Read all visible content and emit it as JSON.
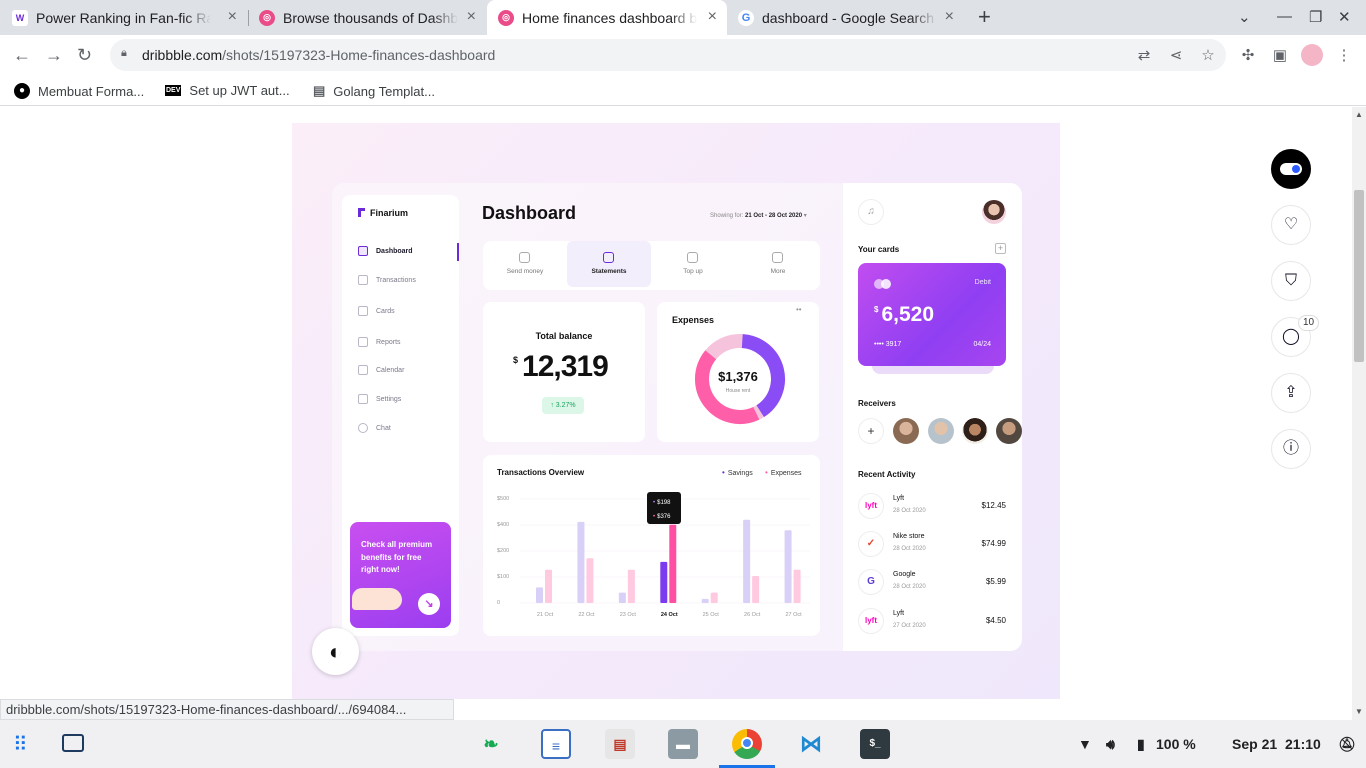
{
  "browser": {
    "tabs": [
      {
        "title": "Power Ranking in Fan-fic Ra",
        "favicon": "W"
      },
      {
        "title": "Browse thousands of Dashb",
        "favicon": "dribbble"
      },
      {
        "title": "Home finances dashboard b",
        "favicon": "dribbble"
      },
      {
        "title": "dashboard - Google Search",
        "favicon": "G"
      }
    ],
    "new_tab": "+",
    "url_host": "dribbble.com",
    "url_path": "/shots/15197323-Home-finances-dashboard",
    "bookmarks": [
      "Membuat Forma...",
      "Set up JWT aut...",
      "Golang Templat..."
    ],
    "status_url": "dribbble.com/shots/15197323-Home-finances-dashboard/.../694084..."
  },
  "dashboard": {
    "brand": "Finarium",
    "nav": [
      "Dashboard",
      "Transactions",
      "Cards",
      "Reports",
      "Calendar",
      "Settings",
      "Chat"
    ],
    "promo": "Check all premium benefits for free right now!",
    "title": "Dashboard",
    "showing_label": "Showing for:",
    "showing_range": "21 Oct - 28 Oct 2020",
    "actions": [
      "Send money",
      "Statements",
      "Top up",
      "More"
    ],
    "total_balance": {
      "label": "Total balance",
      "currency": "$",
      "amount": "12,319",
      "change": "3.27%"
    },
    "expenses": {
      "label": "Expenses",
      "amount": "$1,376",
      "sub": "House rent"
    },
    "overview": {
      "title": "Transactions Overview",
      "legend": [
        "Savings",
        "Expenses"
      ],
      "tooltip": [
        "$198",
        "$376"
      ]
    },
    "right": {
      "cards_label": "Your cards",
      "card": {
        "type": "Debit",
        "currency": "$",
        "amount": "6,520",
        "number": "•••• 3917",
        "expiry": "04/24"
      },
      "receivers_label": "Receivers",
      "activity_label": "Recent Activity",
      "activity": [
        {
          "name": "Lyft",
          "date": "28 Oct 2020",
          "amount": "$12.45"
        },
        {
          "name": "Nike store",
          "date": "28 Oct 2020",
          "amount": "$74.99"
        },
        {
          "name": "Google",
          "date": "28 Oct 2020",
          "amount": "$5.99"
        },
        {
          "name": "Lyft",
          "date": "27 Oct 2020",
          "amount": "$4.50"
        }
      ]
    }
  },
  "chart_data": {
    "type": "bar",
    "title": "Transactions Overview",
    "categories": [
      "21 Oct",
      "22 Oct",
      "23 Oct",
      "24 Oct",
      "25 Oct",
      "26 Oct",
      "27 Oct"
    ],
    "y_ticks": [
      "$500",
      "$400",
      "$200",
      "$100",
      "0"
    ],
    "series": [
      {
        "name": "Savings",
        "values": [
          75,
          390,
          50,
          198,
          20,
          400,
          350
        ]
      },
      {
        "name": "Expenses",
        "values": [
          160,
          215,
          160,
          376,
          50,
          130,
          160
        ]
      }
    ],
    "ylim": [
      0,
      500
    ],
    "highlight": "24 Oct"
  },
  "donut": {
    "purple_fraction": 0.42
  },
  "shot_actions": {
    "comments_count": "10"
  },
  "taskbar": {
    "battery": "100 %",
    "date": "Sep 21",
    "time": "21:10"
  },
  "colors": {
    "accent": "#6c2bd9",
    "pink": "#ff5fa8",
    "card": "#b34cf0"
  }
}
